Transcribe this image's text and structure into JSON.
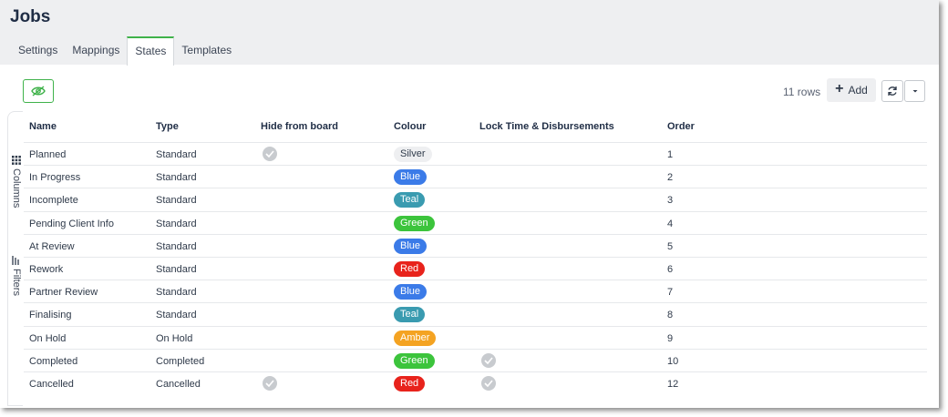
{
  "page": {
    "title": "Jobs"
  },
  "tabs": [
    {
      "label": "Settings",
      "active": false
    },
    {
      "label": "Mappings",
      "active": false
    },
    {
      "label": "States",
      "active": true
    },
    {
      "label": "Templates",
      "active": false
    }
  ],
  "toolbar": {
    "hide_icon": "eye-slash-icon",
    "row_count": "11 rows",
    "add_label": "Add",
    "refresh_icon": "refresh-icon",
    "menu_icon": "caret-down-icon"
  },
  "side_panel": {
    "columns_label": "Columns",
    "filters_label": "Filters"
  },
  "colors": {
    "accent": "#3fb24a",
    "Silver": "#eeeff1",
    "Blue": "#3b7be8",
    "Teal": "#3a9bb0",
    "Green": "#3cc43c",
    "Red": "#e8231c",
    "Amber": "#f4a322"
  },
  "table": {
    "columns": [
      "Name",
      "Type",
      "Hide from board",
      "Colour",
      "Lock Time & Disbursements",
      "Order"
    ],
    "rows": [
      {
        "name": "Planned",
        "type": "Standard",
        "hide": true,
        "colour": "Silver",
        "lock": false,
        "order": "1"
      },
      {
        "name": "In Progress",
        "type": "Standard",
        "hide": false,
        "colour": "Blue",
        "lock": false,
        "order": "2"
      },
      {
        "name": "Incomplete",
        "type": "Standard",
        "hide": false,
        "colour": "Teal",
        "lock": false,
        "order": "3"
      },
      {
        "name": "Pending Client Info",
        "type": "Standard",
        "hide": false,
        "colour": "Green",
        "lock": false,
        "order": "4"
      },
      {
        "name": "At Review",
        "type": "Standard",
        "hide": false,
        "colour": "Blue",
        "lock": false,
        "order": "5"
      },
      {
        "name": "Rework",
        "type": "Standard",
        "hide": false,
        "colour": "Red",
        "lock": false,
        "order": "6"
      },
      {
        "name": "Partner Review",
        "type": "Standard",
        "hide": false,
        "colour": "Blue",
        "lock": false,
        "order": "7"
      },
      {
        "name": "Finalising",
        "type": "Standard",
        "hide": false,
        "colour": "Teal",
        "lock": false,
        "order": "8"
      },
      {
        "name": "On Hold",
        "type": "On Hold",
        "hide": false,
        "colour": "Amber",
        "lock": false,
        "order": "9"
      },
      {
        "name": "Completed",
        "type": "Completed",
        "hide": false,
        "colour": "Green",
        "lock": true,
        "order": "10"
      },
      {
        "name": "Cancelled",
        "type": "Cancelled",
        "hide": true,
        "colour": "Red",
        "lock": true,
        "order": "12"
      }
    ]
  }
}
